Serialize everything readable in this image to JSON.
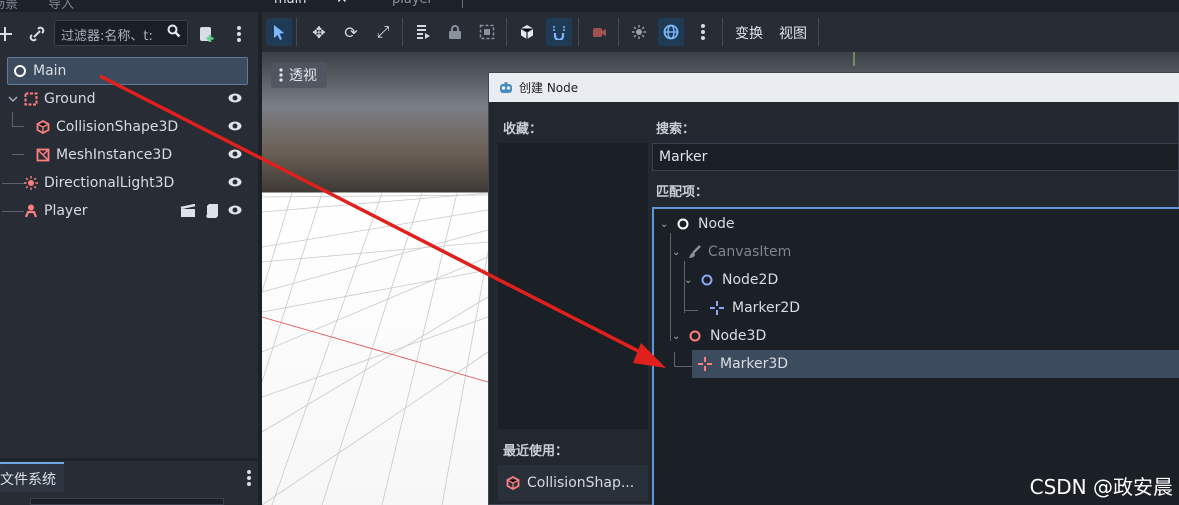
{
  "scene_dock": {
    "tabs": [
      "场景",
      "导入"
    ],
    "filter_placeholder": "过滤器:名称、t:",
    "tree": [
      {
        "label": "Main",
        "icon": "node-circle-icon",
        "selected": true
      },
      {
        "label": "Ground",
        "icon": "static-body-icon"
      },
      {
        "label": "CollisionShape3D",
        "icon": "collision-shape-icon"
      },
      {
        "label": "MeshInstance3D",
        "icon": "mesh-instance-icon"
      },
      {
        "label": "DirectionalLight3D",
        "icon": "directional-light-icon"
      },
      {
        "label": "Player",
        "icon": "player-icon"
      }
    ]
  },
  "filesystem_dock": {
    "tab": "文件系统"
  },
  "editor_tabs": [
    "main",
    "player"
  ],
  "toolbar": {
    "transform_menu": "变换",
    "view_menu": "视图"
  },
  "viewport": {
    "perspective_label": "透视"
  },
  "dialog": {
    "title": "创建 Node",
    "favorites_label": "收藏：",
    "search_label": "搜索：",
    "search_value": "Marker",
    "matches_label": "匹配项：",
    "recent_label": "最近使用：",
    "recent_items": [
      "CollisionShap..."
    ],
    "matches": [
      {
        "label": "Node",
        "icon": "node-circle-icon"
      },
      {
        "label": "CanvasItem",
        "icon": "brush-icon",
        "dimmed": true
      },
      {
        "label": "Node2D",
        "icon": "node2d-circle-icon"
      },
      {
        "label": "Marker2D",
        "icon": "marker2d-icon"
      },
      {
        "label": "Node3D",
        "icon": "node3d-circle-icon"
      },
      {
        "label": "Marker3D",
        "icon": "marker3d-icon",
        "selected": true
      }
    ]
  },
  "watermark": "CSDN @政安晨",
  "colors": {
    "accent": "#5e97d3",
    "annotation_arrow": "#e0201c",
    "node3d": "#fc7f7f",
    "node2d": "#8da5f3"
  }
}
